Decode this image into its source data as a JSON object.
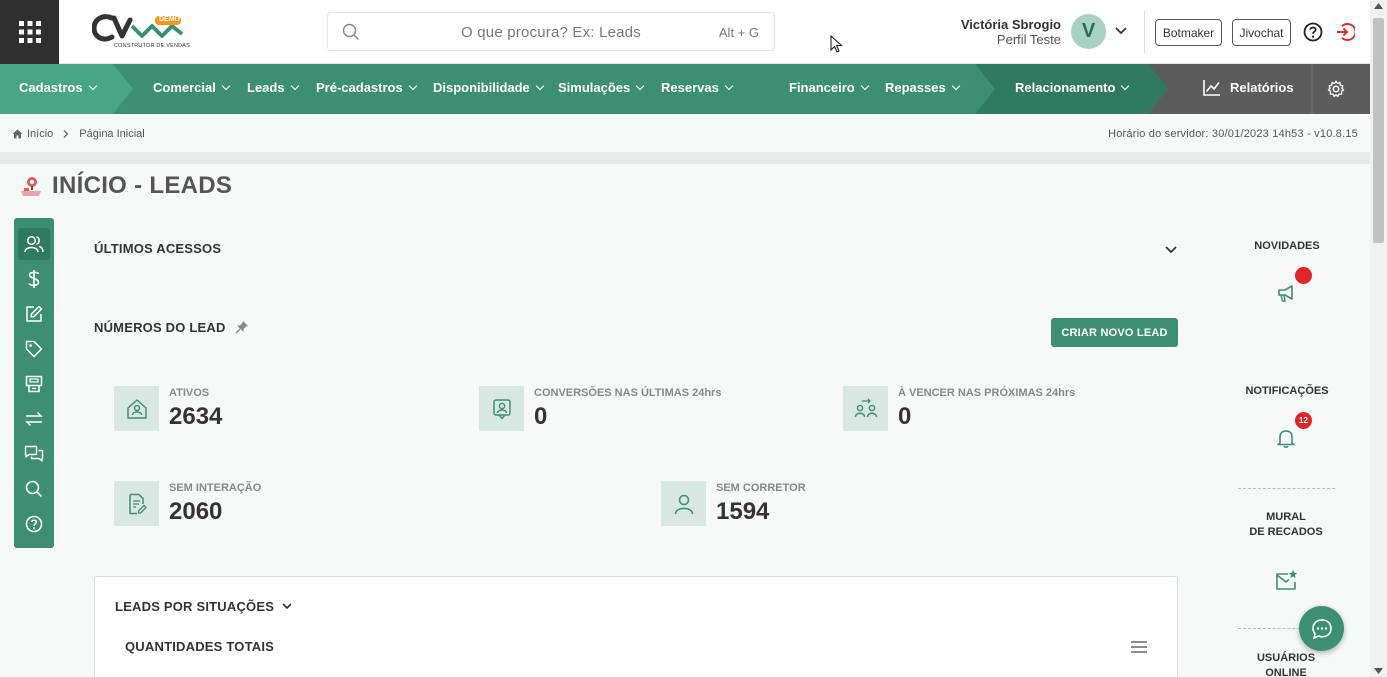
{
  "brand": {
    "logo_text": "CV",
    "demo_badge": "DEMO",
    "tagline": "CONSTRUTOR DE VENDAS"
  },
  "search": {
    "placeholder": "O que procura? Ex: Leads",
    "shortcut": "Alt + G"
  },
  "user": {
    "name": "Victória Sbrogio",
    "profile": "Perfil Teste",
    "initial": "V"
  },
  "top_buttons": {
    "botmaker": "Botmaker",
    "jivochat": "Jivochat"
  },
  "nav": {
    "cadastros": "Cadastros",
    "comercial": "Comercial",
    "leads": "Leads",
    "pre_cadastros": "Pré-cadastros",
    "disponibilidade": "Disponibilidade",
    "simulacoes": "Simulações",
    "reservas": "Reservas",
    "financeiro": "Financeiro",
    "repasses": "Repasses",
    "relacionamento": "Relacionamento",
    "relatorios": "Relatórios"
  },
  "breadcrumb": {
    "home": "Início",
    "current": "Página Inicial"
  },
  "server_time": "Horário do servidor: 30/01/2023 14h53 - v10.8.15",
  "page_title": "INÍCIO - LEADS",
  "sections": {
    "recent": "ÚLTIMOS ACESSOS",
    "numbers": "NÚMEROS DO LEAD",
    "create_lead": "CRIAR NOVO LEAD"
  },
  "stats": {
    "ativos": {
      "label": "ATIVOS",
      "value": "2634"
    },
    "conversoes": {
      "label": "CONVERSÕES NAS ÚLTIMAS 24hrs",
      "value": "0"
    },
    "vencer": {
      "label": "À VENCER NAS PRÓXIMAS 24hrs",
      "value": "0"
    },
    "sem_interacao": {
      "label": "SEM INTERAÇÃO",
      "value": "2060"
    },
    "sem_corretor": {
      "label": "SEM CORRETOR",
      "value": "1594"
    }
  },
  "situacoes": {
    "title": "LEADS POR SITUAÇÕES",
    "subtitle": "QUANTIDADES TOTAIS"
  },
  "right_panel": {
    "novidades": "NOVIDADES",
    "notificacoes": "NOTIFICAÇÕES",
    "notif_count": "12",
    "mural_line1": "MURAL",
    "mural_line2": "DE RECADOS",
    "usuarios_line1": "USUÁRIOS",
    "usuarios_line2": "ONLINE"
  },
  "colors": {
    "primary": "#3c8f73",
    "dark_segment": "#2f7a60",
    "gray_segment": "#5c5c5c",
    "alert": "#e0262b"
  }
}
